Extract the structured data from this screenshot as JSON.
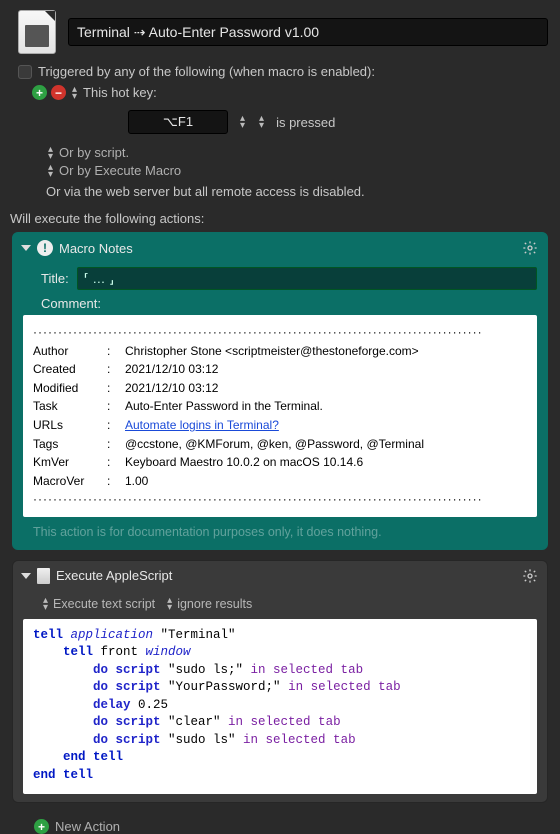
{
  "header": {
    "title": "Terminal ⇢ Auto-Enter Password v1.00"
  },
  "trigger": {
    "checkbox_label": "Triggered by any of the following (when macro is enabled):",
    "hotkey_label": "This hot key:",
    "hotkey_value": "⌥F1",
    "pressed_label": "is pressed",
    "or_script": "Or by script.",
    "or_execute": "Or by Execute Macro",
    "or_web": "Or via the web server but all remote access is disabled.",
    "actions_label": "Will execute the following actions:"
  },
  "notes": {
    "head": "Macro Notes",
    "title_label": "Title:",
    "title_value": "⸢ … ⸥",
    "comment_label": "Comment:",
    "rows": {
      "Author": "Christopher Stone <scriptmeister@thestoneforge.com>",
      "Created": "2021/12/10 03:12",
      "Modified": "2021/12/10 03:12",
      "Task": "Auto-Enter Password in the Terminal.",
      "URLs": "Automate logins in Terminal?",
      "Tags": "@ccstone, @KMForum, @ken, @Password, @Terminal",
      "KmVer": "Keyboard Maestro 10.0.2 on macOS 10.14.6",
      "MacroVer": "1.00"
    },
    "footer": "This action is for documentation purposes only, it does nothing."
  },
  "applescript": {
    "head": "Execute AppleScript",
    "sub_left": "Execute text script",
    "sub_right": "ignore results",
    "lines": [
      {
        "indent": 0,
        "parts": [
          {
            "t": "kw",
            "v": "tell "
          },
          {
            "t": "app",
            "v": "application"
          },
          {
            "t": "str",
            "v": " \"Terminal\""
          }
        ]
      },
      {
        "indent": 1,
        "parts": [
          {
            "t": "kw",
            "v": "tell "
          },
          {
            "t": "str",
            "v": "front "
          },
          {
            "t": "app",
            "v": "window"
          }
        ]
      },
      {
        "indent": 2,
        "parts": [
          {
            "t": "cmd",
            "v": "do script"
          },
          {
            "t": "str",
            "v": " \"sudo ls;\" "
          },
          {
            "t": "sel",
            "v": "in selected tab"
          }
        ]
      },
      {
        "indent": 2,
        "parts": [
          {
            "t": "cmd",
            "v": "do script"
          },
          {
            "t": "str",
            "v": " \"YourPassword;\" "
          },
          {
            "t": "sel",
            "v": "in selected tab"
          }
        ]
      },
      {
        "indent": 2,
        "parts": [
          {
            "t": "cmd",
            "v": "delay"
          },
          {
            "t": "num",
            "v": " 0.25"
          }
        ]
      },
      {
        "indent": 2,
        "parts": [
          {
            "t": "cmd",
            "v": "do script"
          },
          {
            "t": "str",
            "v": " \"clear\" "
          },
          {
            "t": "sel",
            "v": "in selected tab"
          }
        ]
      },
      {
        "indent": 2,
        "parts": [
          {
            "t": "cmd",
            "v": "do script"
          },
          {
            "t": "str",
            "v": " \"sudo ls\" "
          },
          {
            "t": "sel",
            "v": "in selected tab"
          }
        ]
      },
      {
        "indent": 1,
        "parts": [
          {
            "t": "kw",
            "v": "end tell"
          }
        ]
      },
      {
        "indent": 0,
        "parts": [
          {
            "t": "kw",
            "v": "end tell"
          }
        ]
      }
    ]
  },
  "new_action": "New Action"
}
